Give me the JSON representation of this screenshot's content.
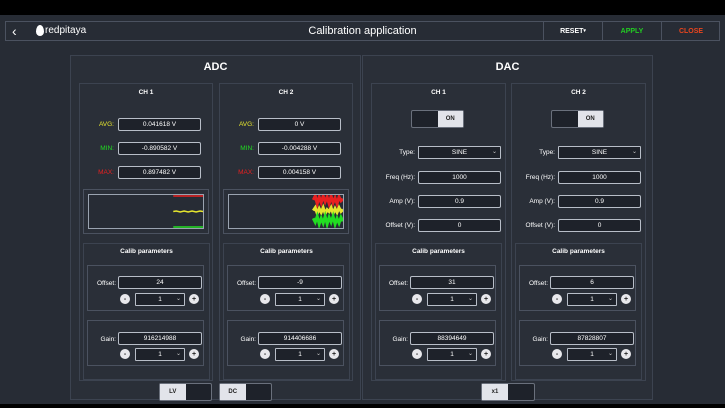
{
  "header": {
    "title": "Calibration application",
    "logo": "redpitaya",
    "reset": "RESET",
    "apply": "APPLY",
    "close": "CLOSE",
    "back_icon": "chevron-left-icon"
  },
  "colors": {
    "avg": "#e6e62e",
    "min": "#22dd22",
    "max": "#e82020",
    "apply": "#22cc22",
    "close": "#e8451e"
  },
  "adc": {
    "title": "ADC",
    "calib_title": "Calib parameters",
    "offset_label": "Offset:",
    "gain_label": "Gain:",
    "avg_label": "AVG:",
    "min_label": "MIN:",
    "max_label": "MAX:",
    "channels": [
      {
        "name": "CH 1",
        "avg": "0.041618 V",
        "min": "-0.890582 V",
        "max": "0.897482 V",
        "offset": "24",
        "offset_step": "1",
        "gain": "916214988",
        "gain_step": "1"
      },
      {
        "name": "CH 2",
        "avg": "0 V",
        "min": "-0.004288 V",
        "max": "0.004158 V",
        "offset": "-9",
        "offset_step": "1",
        "gain": "914406686",
        "gain_step": "1"
      }
    ],
    "mode_toggle": "LV",
    "coupling_toggle": "DC"
  },
  "dac": {
    "title": "DAC",
    "calib_title": "Calib parameters",
    "type_label": "Type:",
    "freq_label": "Freq (Hz):",
    "amp_label": "Amp (V):",
    "offset_v_label": "Offset (V):",
    "offset_label": "Offset:",
    "gain_label": "Gain:",
    "channels": [
      {
        "name": "CH 1",
        "state": "ON",
        "type": "SINE",
        "freq": "1000",
        "amp": "0.9",
        "offset_v": "0",
        "offset": "31",
        "offset_step": "1",
        "gain": "88394649",
        "gain_step": "1"
      },
      {
        "name": "CH 2",
        "state": "ON",
        "type": "SINE",
        "freq": "1000",
        "amp": "0.9",
        "offset_v": "0",
        "offset": "6",
        "offset_step": "1",
        "gain": "87828807",
        "gain_step": "1"
      }
    ],
    "gain_toggle": "x1"
  },
  "stepper": {
    "minus": "-",
    "plus": "+",
    "chev": "⌄"
  }
}
